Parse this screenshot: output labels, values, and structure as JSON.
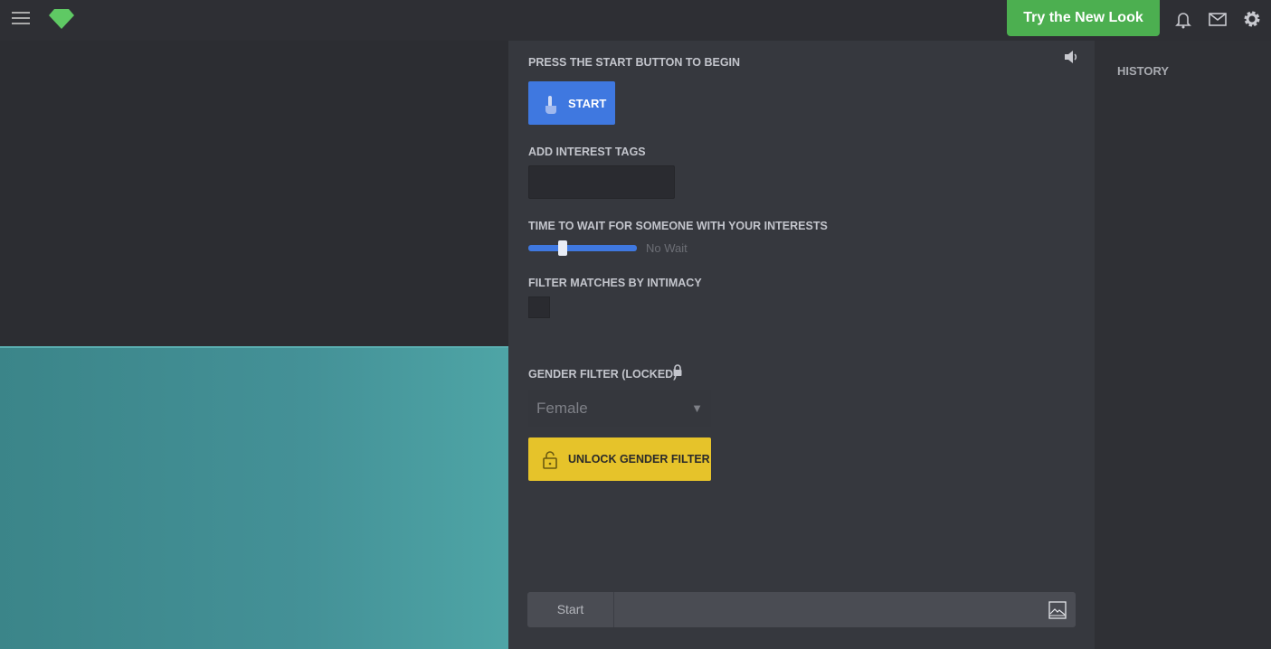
{
  "topbar": {
    "try_label": "Try the New Look",
    "icons": [
      "menu-icon",
      "diamond-logo",
      "bell-icon",
      "mail-icon",
      "gear-icon"
    ],
    "accent": "#4caf50"
  },
  "main": {
    "start_prompt": "PRESS THE START BUTTON TO BEGIN",
    "start_label": "START",
    "interest_label": "ADD INTEREST TAGS",
    "interest_value": "",
    "wait_label": "TIME TO WAIT FOR SOMEONE WITH YOUR INTERESTS",
    "wait_value_text": "No Wait",
    "wait_slider_fraction": 0.3,
    "intimacy_label": "FILTER MATCHES BY INTIMACY",
    "intimacy_checked": false,
    "gender_label": "GENDER FILTER (LOCKED)",
    "gender_value": "Female",
    "unlock_label": "UNLOCK GENDER FILTER",
    "chat_start": "Start",
    "chat_input": ""
  },
  "history": {
    "title": "HISTORY"
  }
}
